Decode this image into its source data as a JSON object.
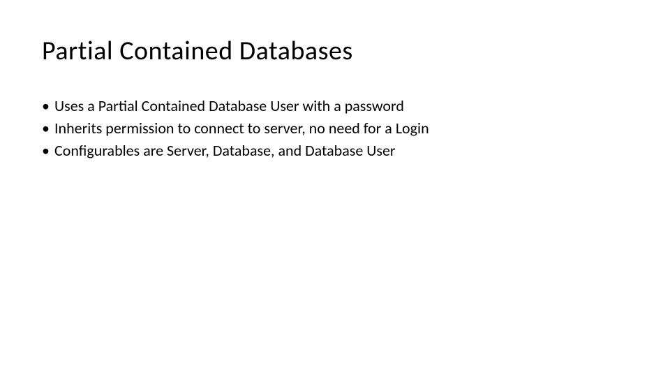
{
  "slide": {
    "title": "Partial Contained Databases",
    "bullets": [
      "Uses a Partial Contained Database User with a password",
      "Inherits permission to connect to server, no need for a Login",
      "Configurables are Server, Database, and Database User"
    ]
  }
}
